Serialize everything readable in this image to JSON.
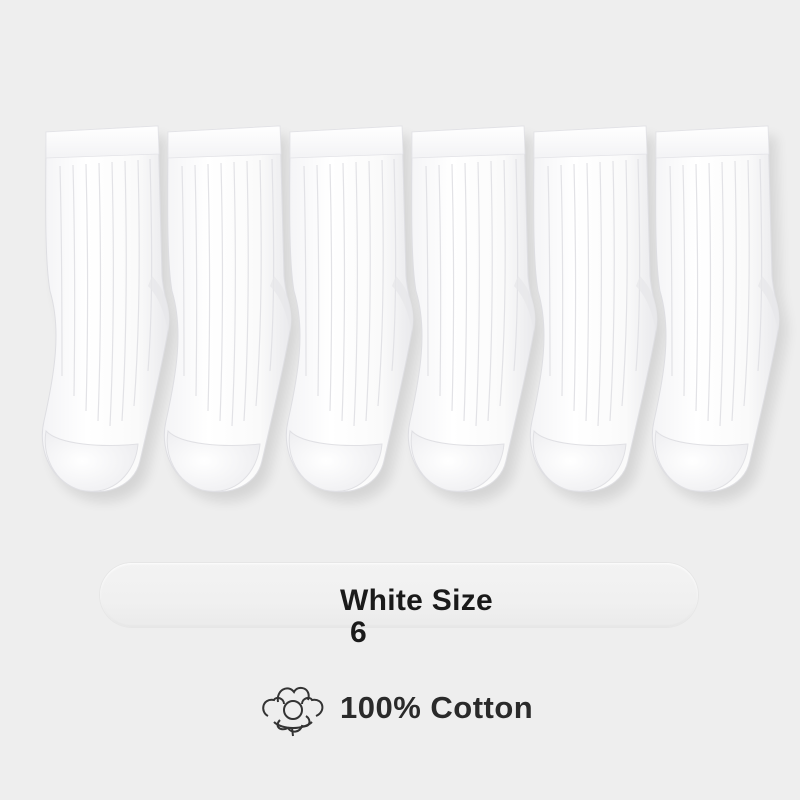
{
  "product": {
    "color_label": "White Size",
    "size_value": "6",
    "material_label": "100% Cotton",
    "sock_count": 6,
    "sock_color": "#ffffff"
  },
  "icons": {
    "material": "cotton-boll-icon"
  },
  "colors": {
    "background": "#eeeeee",
    "text": "#1a1a1a"
  }
}
